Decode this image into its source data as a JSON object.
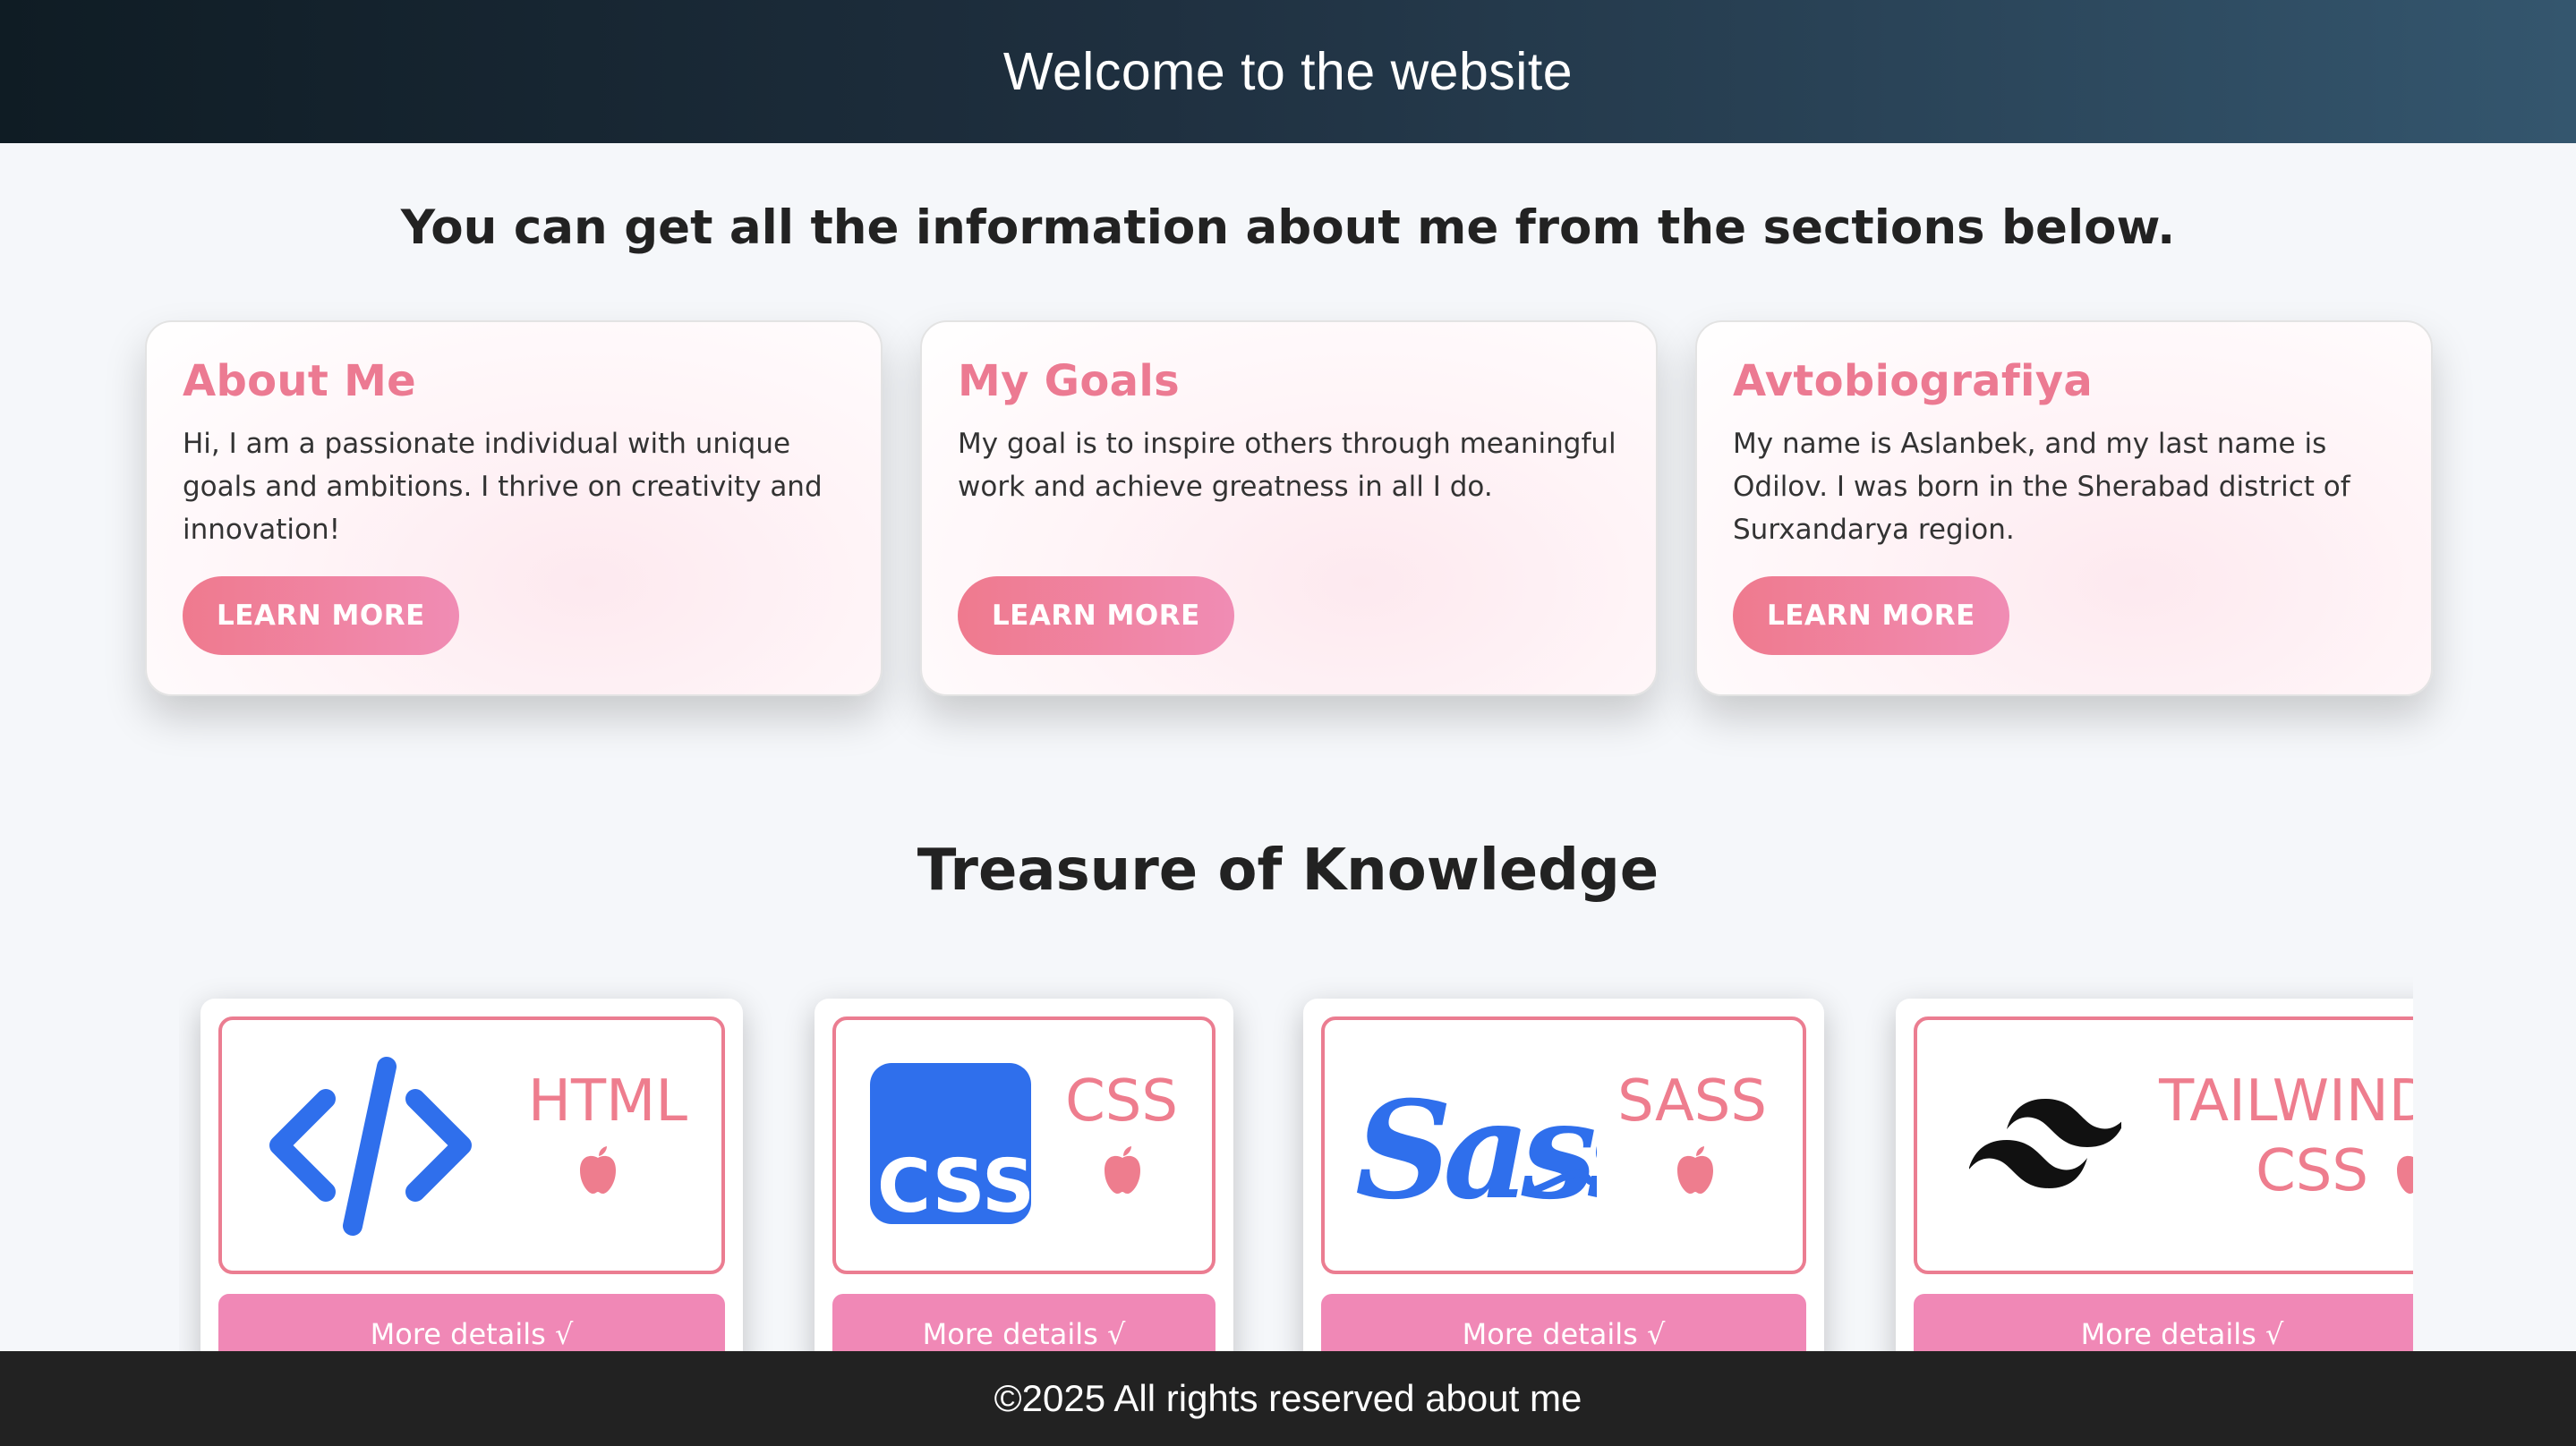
{
  "header": {
    "title": "Welcome to the website"
  },
  "intro": {
    "text": "You can get all the information about me from the sections below."
  },
  "info_cards": [
    {
      "title": "About Me",
      "text": "Hi, I am a passionate individual with unique goals and ambitions. I thrive on creativity and innovation!",
      "button": "LEARN MORE"
    },
    {
      "title": "My Goals",
      "text": "My goal is to inspire others through meaningful work and achieve greatness in all I do.",
      "button": "LEARN MORE"
    },
    {
      "title": "Avtobiografiya",
      "text": "My name is Aslanbek, and my last name is Odilov. I was born in the Sherabad district of Surxandarya region.",
      "button": "LEARN MORE"
    }
  ],
  "knowledge": {
    "title": "Treasure of Knowledge",
    "items": [
      {
        "name": "HTML",
        "logo_icon": "code-brackets-icon",
        "button": "More details √"
      },
      {
        "name": "CSS",
        "logo_icon": "css-logo-icon",
        "button": "More details √"
      },
      {
        "name": "SASS",
        "logo_icon": "sass-logo-icon",
        "button": "More details √"
      },
      {
        "name_line1": "TAILWIND",
        "name_line2": "CSS",
        "logo_icon": "tailwind-logo-icon",
        "button": "More details √"
      }
    ]
  },
  "footer": {
    "text": "©2025 All rights reserved about me"
  },
  "colors": {
    "accent_pink": "#ec7a92",
    "button_pink": "#f088b6",
    "logo_blue": "#2f6fec",
    "footer_bg": "#222222"
  }
}
